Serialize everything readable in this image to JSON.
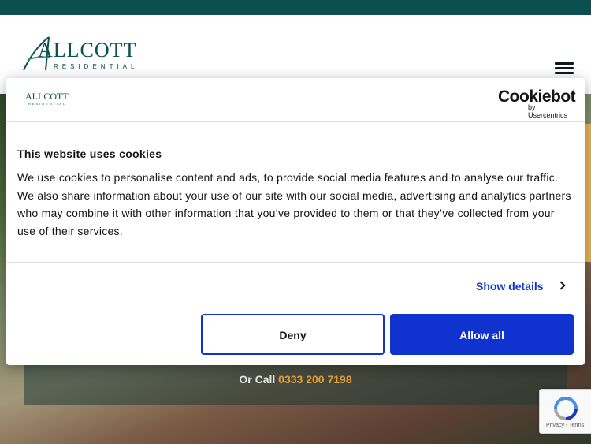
{
  "brand": {
    "name": "ALLCOTT",
    "tagline": "RESIDENTIAL",
    "accent": "#0c4f50"
  },
  "header": {
    "menu_icon": "hamburger-menu-icon"
  },
  "hero": {
    "or_call_prefix": "Or Call",
    "phone": "0333 200 7198",
    "phone_color": "#e3a33a"
  },
  "cookie_banner": {
    "provider": "Cookiebot",
    "provider_by": "by Usercentrics",
    "title": "This website uses cookies",
    "body": "We use cookies to personalise content and ads, to provide social media features and to analyse our traffic. We also share information about your use of our site with our social media, advertising and analytics partners who may combine it with other information that you’ve provided to them or that they’ve collected from your use of their services.",
    "show_details": "Show details",
    "deny_label": "Deny",
    "allow_label": "Allow all",
    "button_color": "#1032cf"
  },
  "recaptcha": {
    "links": "Privacy - Terms"
  }
}
